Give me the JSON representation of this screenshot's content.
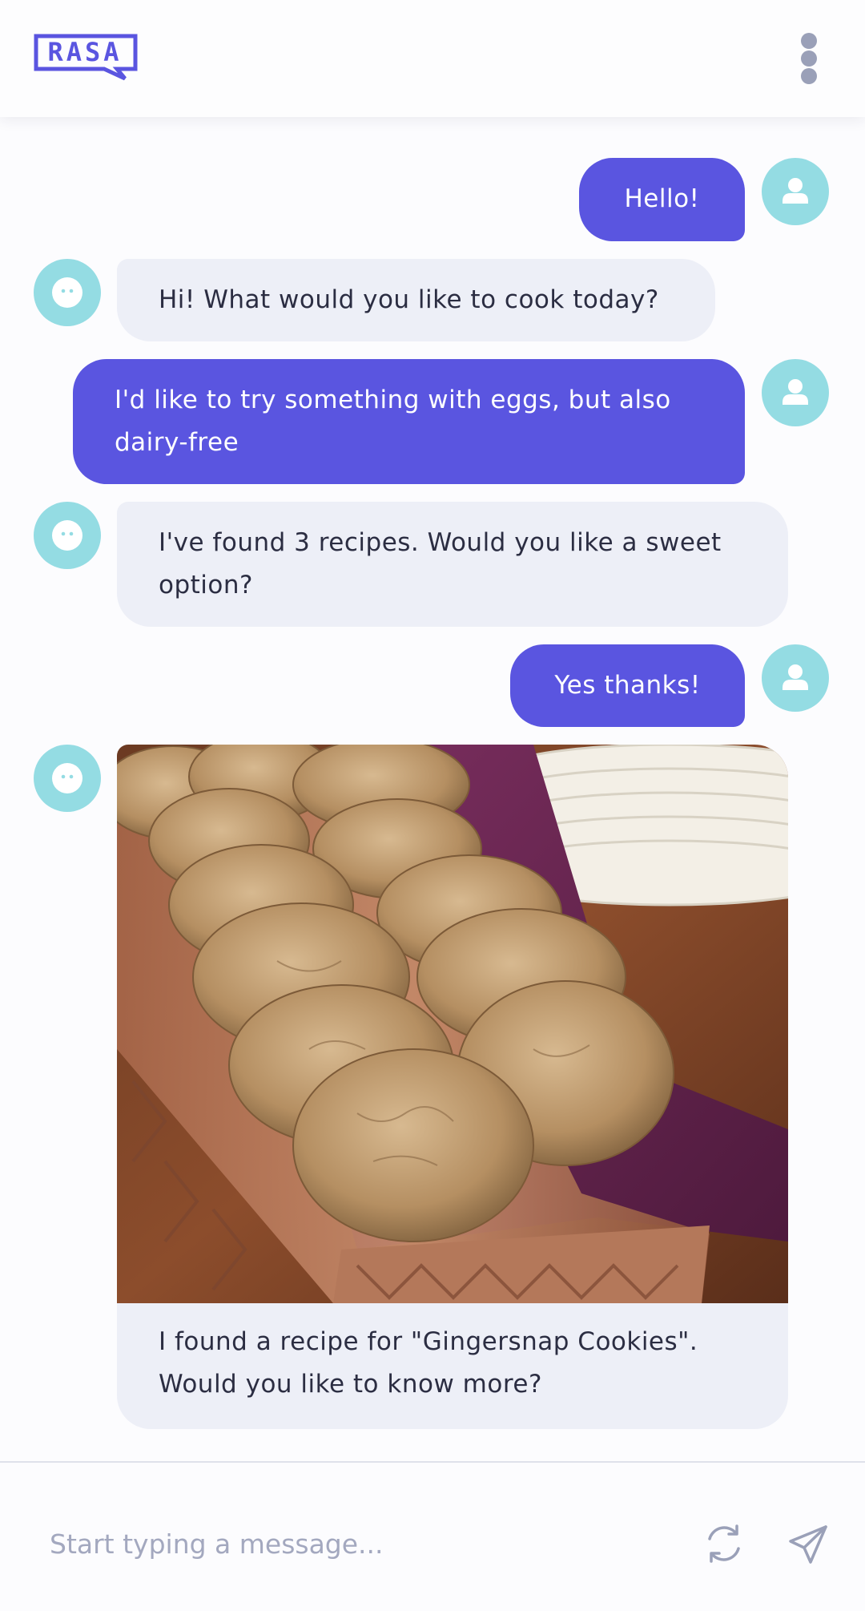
{
  "header": {
    "logo_text": "RASA",
    "menu_icon": "kebab-menu-icon"
  },
  "colors": {
    "accent": "#5a55e0",
    "avatar": "#94dce3",
    "bot_bubble": "#edeff7",
    "icon_grey": "#9aa0b8"
  },
  "messages": [
    {
      "sender": "user",
      "text": "Hello!"
    },
    {
      "sender": "bot",
      "text": "Hi! What would you like to cook today?"
    },
    {
      "sender": "user",
      "text": "I'd like to try something with eggs, but also dairy-free"
    },
    {
      "sender": "bot",
      "text": "I've found 3 recipes. Would you like a sweet option?"
    },
    {
      "sender": "user",
      "text": "Yes thanks!"
    },
    {
      "sender": "bot",
      "type": "card",
      "image": "gingersnap-cookies-photo",
      "text": "I found a recipe for \"Gingersnap Cookies\". Would you like to know more?"
    }
  ],
  "composer": {
    "placeholder": "Start typing a message...",
    "restart_icon": "refresh-icon",
    "send_icon": "send-icon"
  }
}
